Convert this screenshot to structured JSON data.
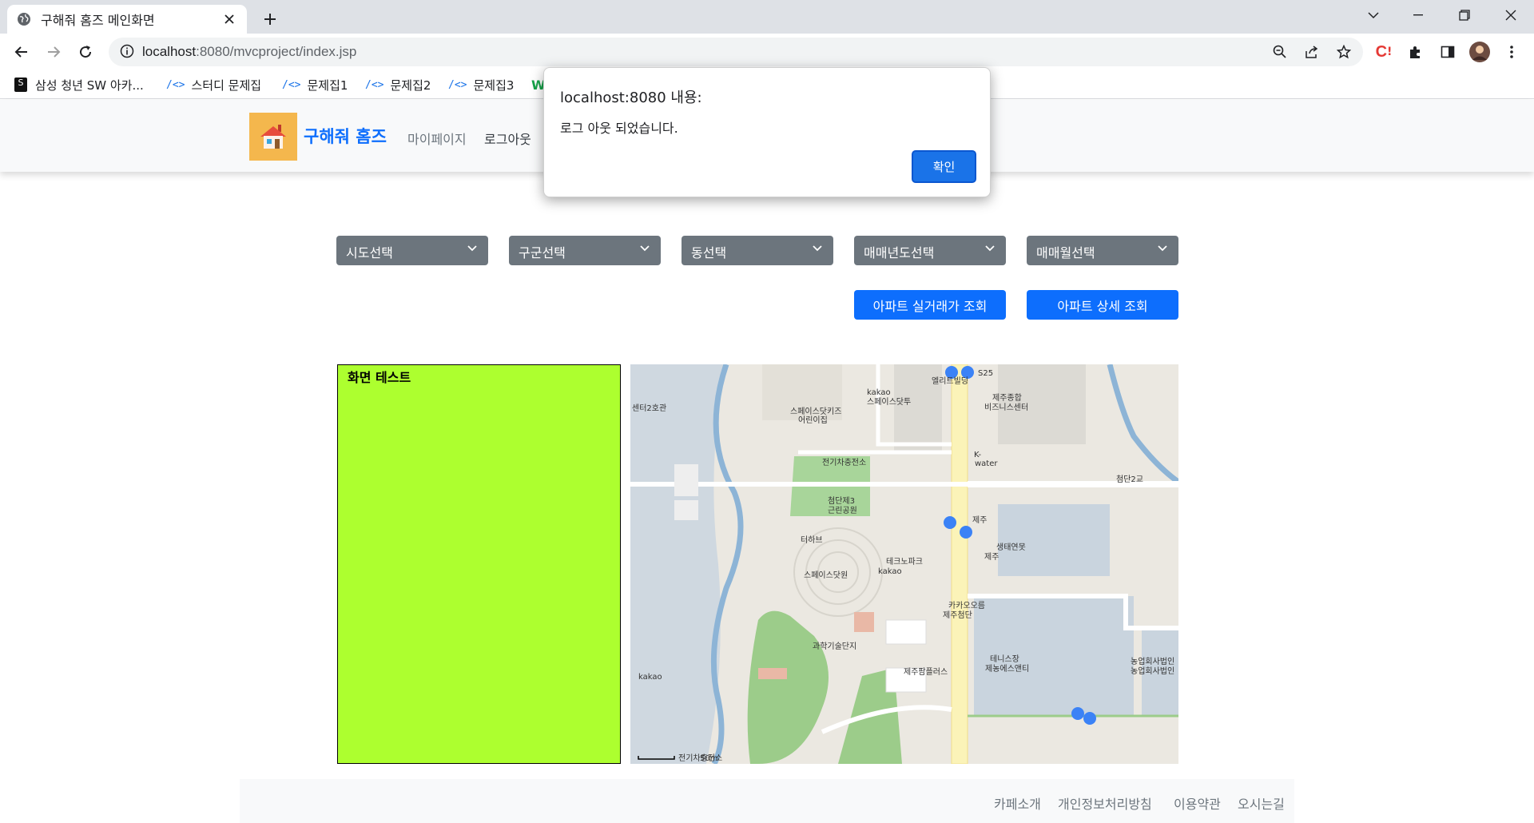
{
  "browser": {
    "tab_title": "구해줘 홈즈 메인화면",
    "url_host": "localhost",
    "url_rest": ":8080/mvcproject/index.jsp",
    "bookmarks": [
      {
        "label": "삼성 청년 SW 아카...",
        "icon": "ssafy-icon"
      },
      {
        "label": "스터디 문제집",
        "icon": "code-icon"
      },
      {
        "label": "문제집1",
        "icon": "code-icon"
      },
      {
        "label": "문제집2",
        "icon": "code-icon"
      },
      {
        "label": "문제집3",
        "icon": "code-icon"
      }
    ]
  },
  "navbar": {
    "brand": "구해줘 홈즈",
    "links": [
      "마이페이지",
      "로그아웃"
    ]
  },
  "filters": {
    "selects": [
      "시도선택",
      "구군선택",
      "동선택",
      "매매년도선택",
      "매매월선택"
    ]
  },
  "actions": {
    "deal_button": "아파트 실거래가 조회",
    "detail_button": "아파트 상세 조회"
  },
  "test_panel": {
    "title": "화면 테스트"
  },
  "map": {
    "labels": [
      "S25",
      "엘리트빌딩",
      "kakao",
      "스페이스닷투",
      "스페이스닷키즈",
      "어린이집",
      "제주종합",
      "비즈니스센터",
      "센터2호관",
      "전기차충전소",
      "K-",
      "water",
      "첨단2교",
      "첨단제3",
      "근린공원",
      "제주",
      "터하브",
      "생태연못",
      "제주",
      "테크노파크",
      "kakao",
      "스페이스닷원",
      "카카오오름",
      "제주첨단",
      "과학기술단지",
      "테니스장",
      "제농에스앤티",
      "농업회사법인",
      "농업회사법인",
      "제주팜플러스",
      "전기차충전소",
      "50m",
      "kakao"
    ]
  },
  "footer": {
    "links": [
      "카페소개",
      "개인정보처리방침",
      "이용약관",
      "오시는길"
    ]
  },
  "dialog": {
    "title": "localhost:8080 내용:",
    "message": "로그 아웃 되었습니다.",
    "ok": "확인"
  },
  "colors": {
    "primary": "#0d6efd",
    "secondary": "#6c757d",
    "panel": "#adff2f",
    "logo_bg": "#f4b74d"
  }
}
